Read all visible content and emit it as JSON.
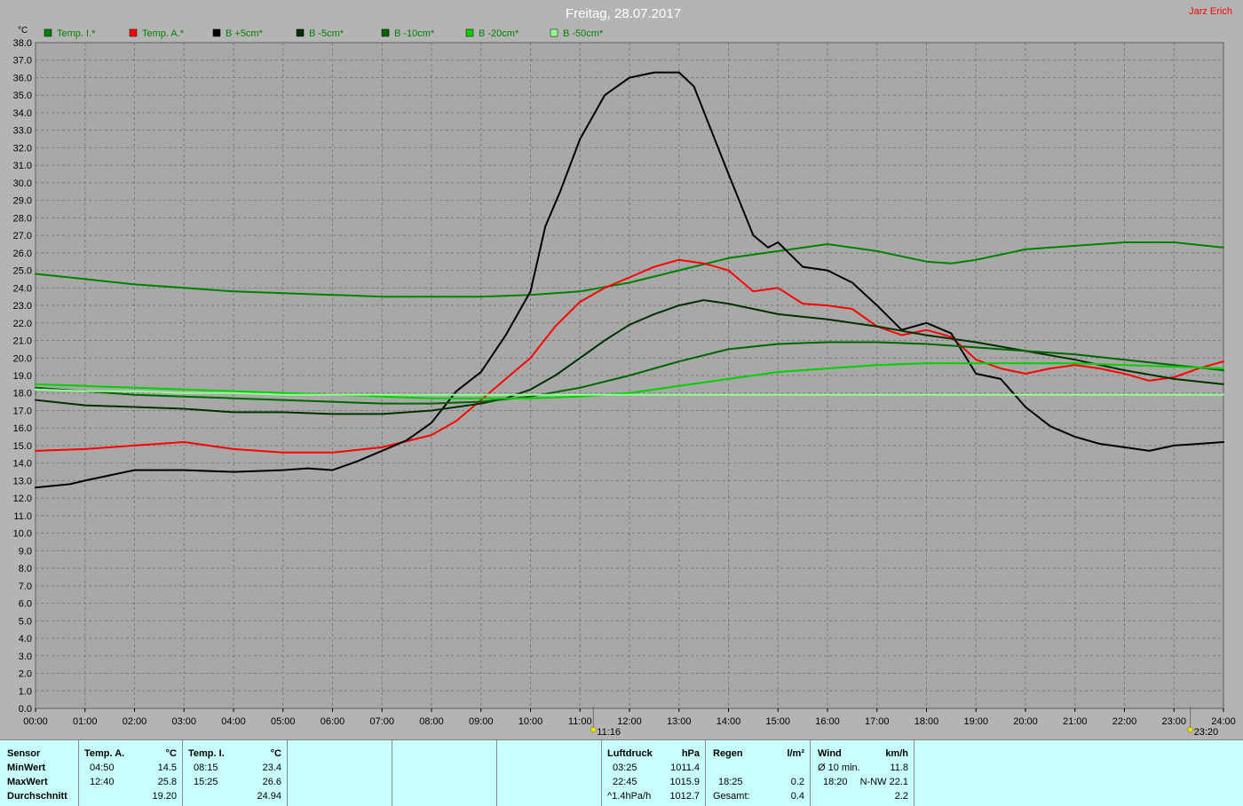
{
  "header": {
    "title": "Freitag, 28.07.2017",
    "author": "Jarz Erich"
  },
  "chart_data": {
    "type": "line",
    "ylabel": "°C",
    "ylim": [
      0,
      38
    ],
    "xlim": [
      0,
      24
    ],
    "grid": true,
    "legend_position": "top",
    "y_ticks": [
      "0.0",
      "1.0",
      "2.0",
      "3.0",
      "4.0",
      "5.0",
      "6.0",
      "7.0",
      "8.0",
      "9.0",
      "10.0",
      "11.0",
      "12.0",
      "13.0",
      "14.0",
      "15.0",
      "16.0",
      "17.0",
      "18.0",
      "19.0",
      "20.0",
      "21.0",
      "22.0",
      "23.0",
      "24.0",
      "25.0",
      "26.0",
      "27.0",
      "28.0",
      "29.0",
      "30.0",
      "31.0",
      "32.0",
      "33.0",
      "34.0",
      "35.0",
      "36.0",
      "37.0",
      "38.0"
    ],
    "x_ticks": [
      "00:00",
      "01:00",
      "02:00",
      "03:00",
      "04:00",
      "05:00",
      "06:00",
      "07:00",
      "08:00",
      "09:00",
      "10:00",
      "11:00",
      "12:00",
      "13:00",
      "14:00",
      "15:00",
      "16:00",
      "17:00",
      "18:00",
      "19:00",
      "20:00",
      "21:00",
      "22:00",
      "23:00",
      "24:00"
    ],
    "sun_markers": [
      {
        "time": "11:16",
        "hour": 11.27
      },
      {
        "time": "23:20",
        "hour": 23.33
      }
    ],
    "series": [
      {
        "name": "Temp. I.*",
        "color": "#008000",
        "x": [
          0,
          1,
          2,
          3,
          4,
          5,
          6,
          7,
          8,
          9,
          10,
          11,
          12,
          13,
          14,
          15,
          16,
          17,
          18,
          18.5,
          19,
          20,
          21,
          22,
          23,
          24
        ],
        "y": [
          24.8,
          24.5,
          24.2,
          24.0,
          23.8,
          23.7,
          23.6,
          23.5,
          23.5,
          23.5,
          23.6,
          23.8,
          24.3,
          25.0,
          25.7,
          26.1,
          26.5,
          26.1,
          25.5,
          25.4,
          25.6,
          26.2,
          26.4,
          26.6,
          26.6,
          26.3
        ]
      },
      {
        "name": "Temp. A.*",
        "color": "#ff0000",
        "x": [
          0,
          1,
          2,
          3,
          4,
          5,
          6,
          7,
          8,
          8.5,
          9,
          9.5,
          10,
          10.5,
          11,
          11.5,
          12,
          12.5,
          13,
          13.5,
          14,
          14.5,
          15,
          15.5,
          16,
          16.5,
          17,
          17.5,
          18,
          18.5,
          19,
          19.5,
          20,
          20.5,
          21,
          21.5,
          22,
          22.5,
          23,
          23.5,
          24
        ],
        "y": [
          14.7,
          14.8,
          15.0,
          15.2,
          14.8,
          14.6,
          14.6,
          14.9,
          15.6,
          16.4,
          17.6,
          18.8,
          20.0,
          21.8,
          23.2,
          24.0,
          24.6,
          25.2,
          25.6,
          25.4,
          25.0,
          23.8,
          24.0,
          23.1,
          23.0,
          22.8,
          21.8,
          21.3,
          21.6,
          21.2,
          19.9,
          19.4,
          19.1,
          19.4,
          19.6,
          19.4,
          19.1,
          18.7,
          18.9,
          19.4,
          19.8
        ]
      },
      {
        "name": "B +5cm*",
        "color": "#000000",
        "x": [
          0,
          0.7,
          1,
          2,
          3,
          4,
          5,
          5.5,
          6,
          6.5,
          7,
          7.5,
          8,
          8.5,
          9,
          9.5,
          10,
          10.3,
          10.6,
          11,
          11.5,
          12,
          12.5,
          13,
          13.3,
          14,
          14.5,
          14.8,
          15,
          15.5,
          16,
          16.5,
          17,
          17.5,
          18,
          18.5,
          19,
          19.5,
          20,
          20.5,
          21,
          21.5,
          22,
          22.5,
          23,
          23.5,
          24
        ],
        "y": [
          12.6,
          12.8,
          13.0,
          13.6,
          13.6,
          13.5,
          13.6,
          13.7,
          13.6,
          14.1,
          14.7,
          15.3,
          16.3,
          18.1,
          19.2,
          21.3,
          23.8,
          27.5,
          29.5,
          32.5,
          35.0,
          36.0,
          36.3,
          36.3,
          35.5,
          30.5,
          27.0,
          26.3,
          26.6,
          25.2,
          25.0,
          24.3,
          23.0,
          21.6,
          22.0,
          21.4,
          19.1,
          18.8,
          17.2,
          16.1,
          15.5,
          15.1,
          14.9,
          14.7,
          15.0,
          15.1,
          15.2
        ]
      },
      {
        "name": "B -5cm*",
        "color": "#003000",
        "x": [
          0,
          1,
          2,
          3,
          4,
          5,
          6,
          7,
          8,
          9,
          9.5,
          10,
          10.5,
          11,
          11.5,
          12,
          12.5,
          13,
          13.5,
          14,
          14.5,
          15,
          16,
          17,
          18,
          19,
          20,
          21,
          22,
          23,
          24
        ],
        "y": [
          17.6,
          17.3,
          17.2,
          17.1,
          16.9,
          16.9,
          16.8,
          16.8,
          17.0,
          17.4,
          17.7,
          18.2,
          19.0,
          20.0,
          21.0,
          21.9,
          22.5,
          23.0,
          23.3,
          23.1,
          22.8,
          22.5,
          22.2,
          21.8,
          21.3,
          20.9,
          20.4,
          19.9,
          19.3,
          18.8,
          18.5
        ]
      },
      {
        "name": "B -10cm*",
        "color": "#006400",
        "x": [
          0,
          1,
          2,
          3,
          4,
          5,
          6,
          7,
          8,
          9,
          10,
          11,
          12,
          13,
          14,
          15,
          16,
          17,
          18,
          19,
          20,
          21,
          22,
          23,
          24
        ],
        "y": [
          18.3,
          18.1,
          17.9,
          17.8,
          17.7,
          17.6,
          17.5,
          17.4,
          17.4,
          17.5,
          17.8,
          18.3,
          19.0,
          19.8,
          20.5,
          20.8,
          20.9,
          20.9,
          20.8,
          20.6,
          20.4,
          20.2,
          19.9,
          19.6,
          19.3
        ]
      },
      {
        "name": "B -20cm*",
        "color": "#00d000",
        "x": [
          0,
          1,
          2,
          3,
          4,
          5,
          6,
          7,
          8,
          9,
          10,
          11,
          12,
          13,
          14,
          15,
          16,
          17,
          18,
          19,
          20,
          21,
          22,
          23,
          24
        ],
        "y": [
          18.5,
          18.4,
          18.3,
          18.2,
          18.1,
          18.0,
          17.9,
          17.8,
          17.7,
          17.7,
          17.7,
          17.8,
          18.0,
          18.4,
          18.8,
          19.2,
          19.4,
          19.6,
          19.7,
          19.7,
          19.7,
          19.7,
          19.6,
          19.5,
          19.4
        ]
      },
      {
        "name": "B -50cm*",
        "color": "#90ff90",
        "x": [
          0,
          1,
          2,
          3,
          4,
          5,
          6,
          7,
          8,
          9,
          10,
          11,
          12,
          13,
          14,
          15,
          16,
          17,
          18,
          19,
          20,
          21,
          22,
          23,
          24
        ],
        "y": [
          18.2,
          18.1,
          18.1,
          18.0,
          18.0,
          17.9,
          17.9,
          17.9,
          17.9,
          17.9,
          17.9,
          17.9,
          17.9,
          17.9,
          17.9,
          17.9,
          17.9,
          17.9,
          17.9,
          17.9,
          17.9,
          17.9,
          17.9,
          17.9,
          17.9
        ]
      }
    ]
  },
  "stats": {
    "sensor": {
      "header": "Sensor",
      "min": "MinWert",
      "max": "MaxWert",
      "avg": "Durchschnitt"
    },
    "temp_a": {
      "header": "Temp. A.",
      "unit": "°C",
      "min_time": "04:50",
      "min_val": "14.5",
      "max_time": "12:40",
      "max_val": "25.8",
      "avg": "19.20"
    },
    "temp_i": {
      "header": "Temp. I.",
      "unit": "°C",
      "min_time": "08:15",
      "min_val": "23.4",
      "max_time": "15:25",
      "max_val": "26.6",
      "avg": "24.94"
    },
    "pressure": {
      "header": "Luftdruck",
      "unit": "hPa",
      "min_time": "03:25",
      "min_val": "1011.4",
      "max_time": "22:45",
      "max_val": "1015.9",
      "trend": "^1.4hPa/h",
      "current": "1012.7"
    },
    "rain": {
      "header": "Regen",
      "unit": "l/m²",
      "max_time": "18:25",
      "max_val": "0.2",
      "total_label": "Gesamt:",
      "total": "0.4"
    },
    "wind": {
      "header": "Wind",
      "unit": "km/h",
      "avg_label": "Ø 10 min.",
      "avg_val": "11.8",
      "max_time": "18:20",
      "max_dir_val": "N-NW 22.1",
      "mean": "2.2"
    }
  }
}
